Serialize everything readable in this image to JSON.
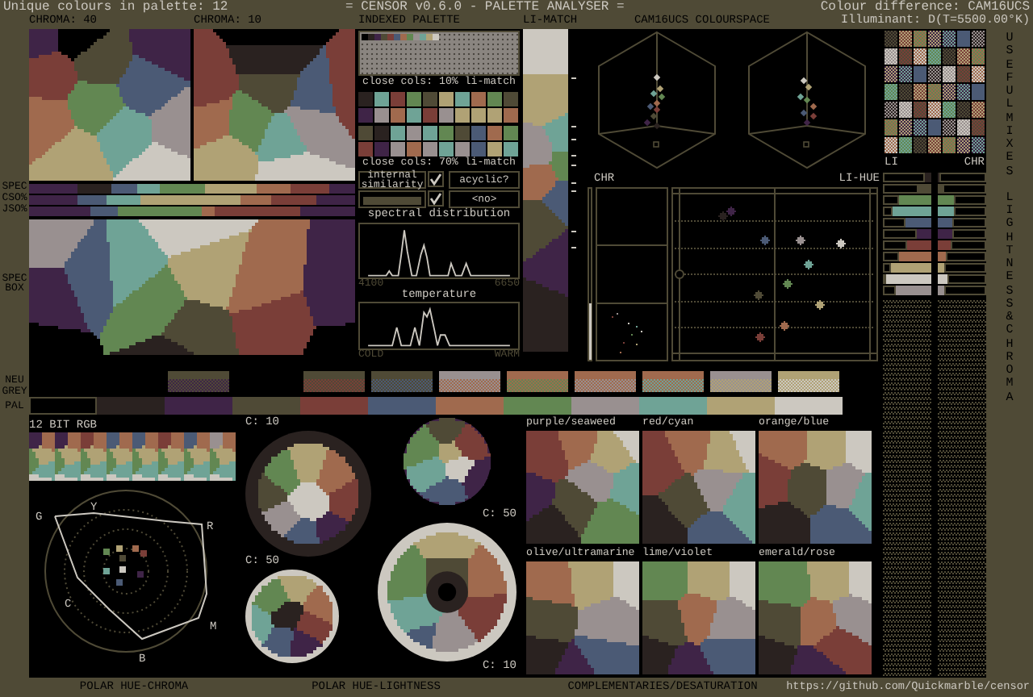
{
  "header": {
    "summary": "Unique colours in palette: 12",
    "title": "= CENSOR v0.6.0 - PALETTE ANALYSER =",
    "metric": "Colour difference: CAM16UCS",
    "illuminant": "Illuminant: D(T=5500.00°K)"
  },
  "palette": [
    {
      "color": "#000000"
    },
    {
      "color": "#2a2220"
    },
    {
      "color": "#3f2447"
    },
    {
      "color": "#4f4a36"
    },
    {
      "color": "#7a3e38"
    },
    {
      "color": "#4b5a75"
    },
    {
      "color": "#a06a4e"
    },
    {
      "color": "#628752"
    },
    {
      "color": "#999090"
    },
    {
      "color": "#6fa396"
    },
    {
      "color": "#b0a275"
    },
    {
      "color": "#ccc8c0"
    }
  ],
  "chroma_views": [
    {
      "label": "CHROMA: 40"
    },
    {
      "label": "CHROMA: 10"
    }
  ],
  "indexed_palette": {
    "title": "INDEXED PALETTE"
  },
  "close_colours": [
    {
      "label": "close cols: 10% li-match"
    },
    {
      "label": "close cols: 70% li-match"
    }
  ],
  "options": [
    {
      "label": "internal similarity",
      "checked": true,
      "level": 1
    },
    {
      "label": "acyclic?",
      "checked": true,
      "value": "<no>"
    }
  ],
  "spectral_distribution": {
    "title": "spectral distribution",
    "min_label": "4100",
    "max_label": "6650"
  },
  "temperature": {
    "title": "temperature",
    "min_label": "COLD",
    "max_label": "WARM"
  },
  "li_match": {
    "title": "LI-MATCH"
  },
  "colourspace": {
    "title": "CAM16UCS COLOURSPACE",
    "chr_title": "CHR",
    "li_hue_title": "LI-HUE"
  },
  "spec_rows": [
    {
      "label": "SPEC"
    },
    {
      "label": "CSO%"
    },
    {
      "label": "JSO%"
    }
  ],
  "spec_box": {
    "label": "SPEC BOX"
  },
  "neutral_grey": {
    "label": "NEU GREY"
  },
  "pal_row": {
    "label": "PAL"
  },
  "rgb12": {
    "title": "12 BIT RGB"
  },
  "polar_hue_chroma": {
    "label": "POLAR HUE-CHROMA",
    "hues": [
      {
        "letter": "G"
      },
      {
        "letter": "Y"
      },
      {
        "letter": "R"
      },
      {
        "letter": "C"
      },
      {
        "letter": "M"
      },
      {
        "letter": "B"
      }
    ]
  },
  "polar_hue_lightness": {
    "label": "POLAR HUE-LIGHTNESS",
    "wheels": [
      {
        "label": "C: 10"
      },
      {
        "label": "C: 50"
      },
      {
        "label": "C: 50"
      },
      {
        "label": "C: 10"
      }
    ]
  },
  "complementaries": {
    "label": "COMPLEMENTARIES/DESATURATION",
    "pairs": [
      {
        "label": "purple/seaweed"
      },
      {
        "label": "red/cyan"
      },
      {
        "label": "orange/blue"
      },
      {
        "label": "olive/ultramarine"
      },
      {
        "label": "lime/violet"
      },
      {
        "label": "emerald/rose"
      }
    ]
  },
  "useful_mixes": {
    "label": "USEFUL MIXES"
  },
  "lightness_chroma": {
    "label": "LIGHTNESS & CHROMA",
    "li_title": "LI",
    "chr_title": "CHR"
  },
  "footer": {
    "url": "https://github.com/Quickmarble/censor"
  }
}
